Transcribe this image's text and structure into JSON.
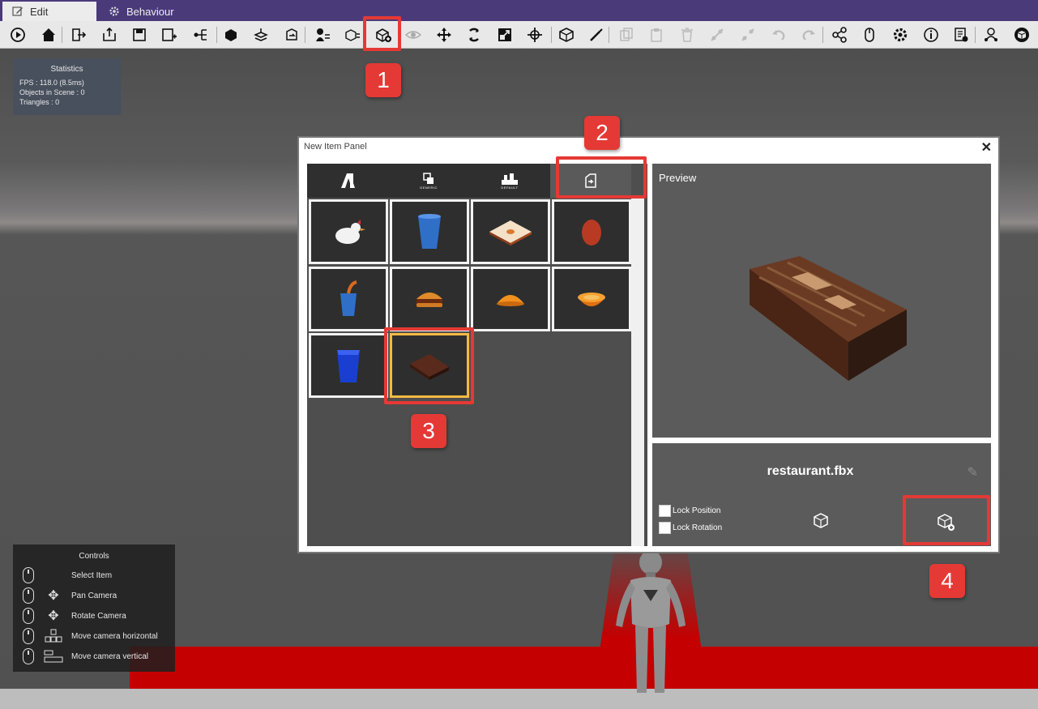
{
  "tabs": [
    {
      "label": "Edit",
      "icon": "edit-icon",
      "active": true
    },
    {
      "label": "Behaviour",
      "icon": "gear-icon",
      "active": false
    }
  ],
  "toolbar": {
    "buttons": [
      "play-icon",
      "home-icon",
      "import-icon",
      "export-icon",
      "save-icon",
      "save-as-icon",
      "hierarchy-icon",
      "package-icon",
      "unpack-icon",
      "refresh-icon",
      "person-list-icon",
      "box-list-icon",
      "new-item-icon",
      "eye-icon",
      "move-icon",
      "rotate-icon",
      "scale-icon",
      "transform-icon",
      "cube-icon",
      "wand-icon",
      "copy-icon",
      "paste-icon",
      "delete-icon",
      "link-icon",
      "unlink-icon",
      "undo-icon",
      "redo-icon",
      "share-icon",
      "mouse-icon",
      "settings-icon",
      "info-icon",
      "log-icon",
      "users-icon",
      "brand-icon"
    ]
  },
  "statistics": {
    "title": "Statistics",
    "fps": "FPS : 118.0 (8.5ms)",
    "objects": "Objects in Scene : 0",
    "triangles": "Triangles : 0"
  },
  "controls": {
    "title": "Controls",
    "rows": [
      {
        "label": "Select Item"
      },
      {
        "label": "Pan Camera"
      },
      {
        "label": "Rotate Camera"
      },
      {
        "label": "Move camera horizontal"
      },
      {
        "label": "Move camera vertical"
      }
    ]
  },
  "panel": {
    "title": "New Item Panel",
    "close": "✕",
    "categories": [
      {
        "name": "brand",
        "icon": "brand-a-icon",
        "caption": ""
      },
      {
        "name": "generic",
        "icon": "generic-icon",
        "caption": "GENERIC"
      },
      {
        "name": "default",
        "icon": "default-icon",
        "caption": "DEFAULT"
      },
      {
        "name": "imported",
        "icon": "import-file-icon",
        "caption": ""
      }
    ],
    "items": [
      {
        "name": "chicken"
      },
      {
        "name": "blue-cup"
      },
      {
        "name": "tray"
      },
      {
        "name": "egg"
      },
      {
        "name": "drink-cup"
      },
      {
        "name": "burger"
      },
      {
        "name": "bun"
      },
      {
        "name": "orange-half"
      },
      {
        "name": "blue-bin"
      },
      {
        "name": "restaurant"
      }
    ],
    "preview_label": "Preview",
    "filename": "restaurant.fbx",
    "lock_position": "Lock Position",
    "lock_rotation": "Lock Rotation"
  },
  "annotations": [
    "1",
    "2",
    "3",
    "4"
  ],
  "colors": {
    "accent_red": "#e53935",
    "selected_border": "#f4b942",
    "tabbar": "#4a3a7a",
    "floor": "#c40000"
  }
}
